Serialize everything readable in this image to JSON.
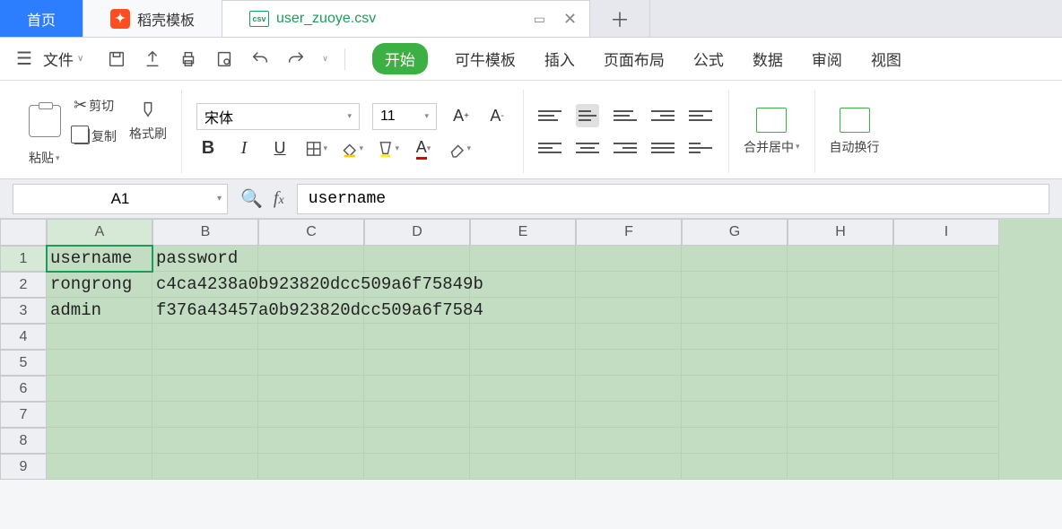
{
  "tabs": {
    "home": "首页",
    "templates": "稻壳模板",
    "file": "user_zuoye.csv"
  },
  "menu": {
    "file": "文件"
  },
  "ribbon": {
    "start": "开始",
    "kntpl": "可牛模板",
    "insert": "插入",
    "layout": "页面布局",
    "formula": "公式",
    "data": "数据",
    "review": "审阅",
    "view": "视图"
  },
  "toolbar": {
    "paste": "粘贴",
    "cut": "剪切",
    "copy": "复制",
    "format_painter": "格式刷",
    "font_name": "宋体",
    "font_size": "11",
    "merge": "合并居中",
    "wrap": "自动换行"
  },
  "formula_bar": {
    "cell_ref": "A1",
    "value": "username"
  },
  "columns": [
    "A",
    "B",
    "C",
    "D",
    "E",
    "F",
    "G",
    "H",
    "I"
  ],
  "rows": [
    "1",
    "2",
    "3",
    "4",
    "5",
    "6",
    "7",
    "8",
    "9"
  ],
  "cells": {
    "A1": "username",
    "B1": "password",
    "A2": "rongrong",
    "B2": "c4ca4238a0b923820dcc509a6f75849b",
    "A3": "admin",
    "B3": "f376a43457a0b923820dcc509a6f7584"
  },
  "active_cell": "A1"
}
